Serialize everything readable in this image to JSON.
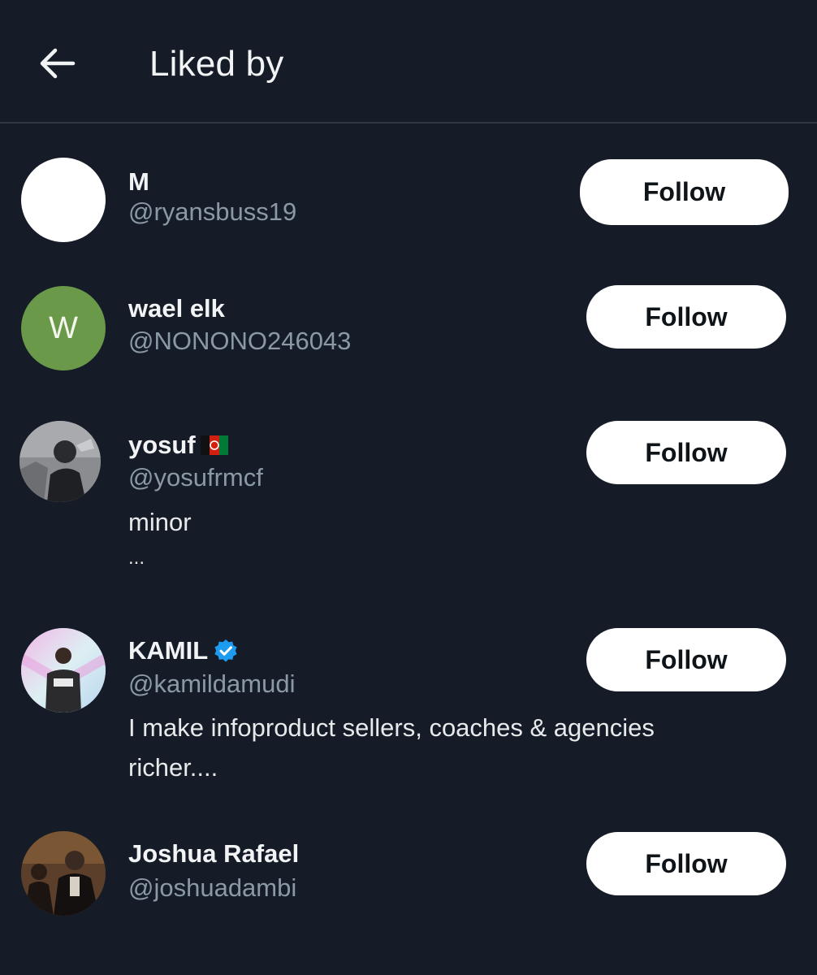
{
  "header": {
    "title": "Liked by",
    "back_icon": "arrow-left-icon"
  },
  "users": [
    {
      "display_name": "M",
      "handle": "@ryansbuss19",
      "follow_label": "Follow",
      "avatar_color": "#ffffff"
    },
    {
      "display_name": "wael elk",
      "handle": "@NONONO246043",
      "follow_label": "Follow",
      "avatar_letter": "W",
      "avatar_color": "#6a9a49"
    },
    {
      "display_name": "yosuf",
      "handle": "@yosufrmcf",
      "bio_line1": "minor",
      "bio_line2": "...",
      "follow_label": "Follow",
      "name_icon": "afghanistan-flag-icon"
    },
    {
      "display_name": "KAMIL",
      "handle": "@kamildamudi",
      "bio_line1": "I make infoproduct sellers, coaches & agencies",
      "bio_line2": "richer....",
      "follow_label": "Follow",
      "name_icon": "verified-badge-icon",
      "badge_color": "#1d9bf0"
    },
    {
      "display_name": "Joshua Rafael",
      "handle": "@joshuadambi",
      "follow_label": "Follow"
    }
  ]
}
